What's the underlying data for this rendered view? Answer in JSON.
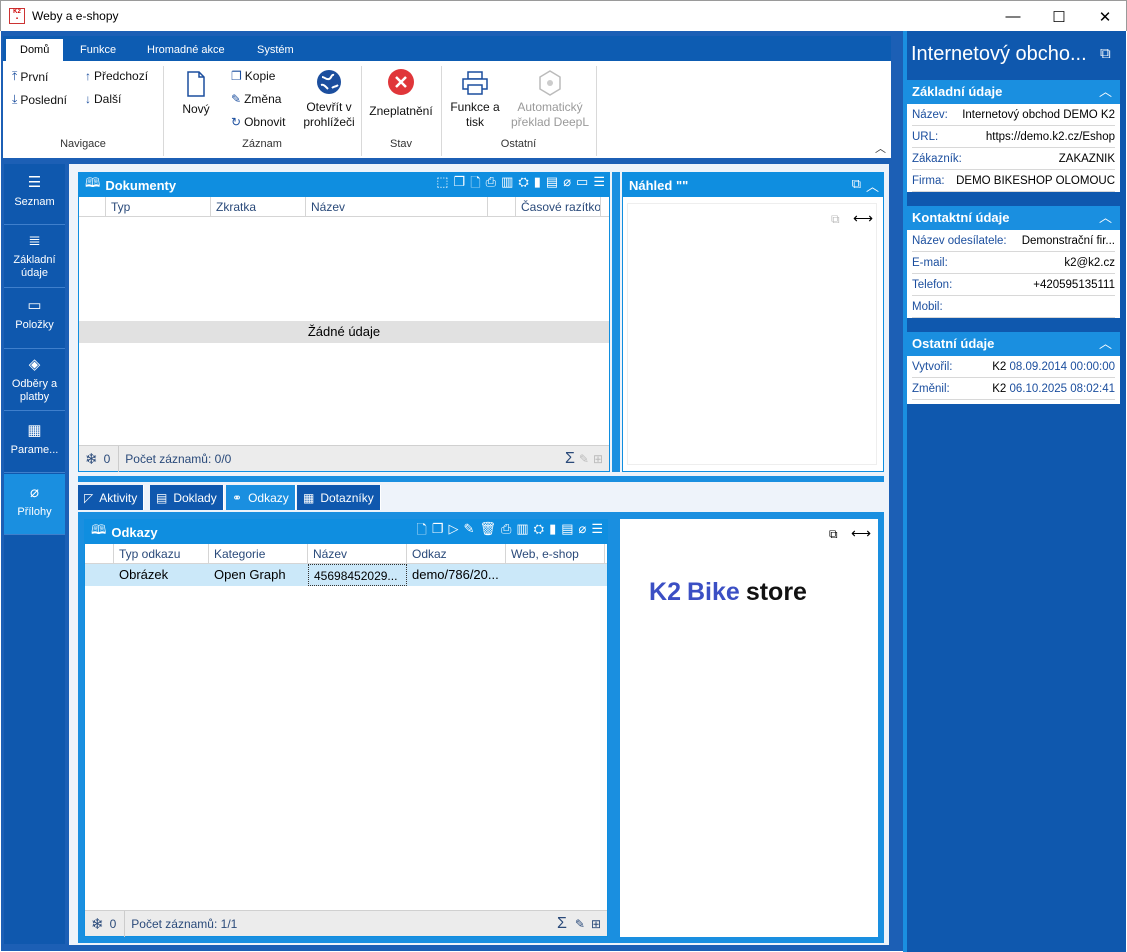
{
  "window": {
    "title": "Weby a e-shopy",
    "minimize": "—",
    "maximize": "☐",
    "close": "✕"
  },
  "ribbon": {
    "tabs": [
      "Domů",
      "Funkce",
      "Hromadné akce",
      "Systém"
    ],
    "nav": {
      "first": "První",
      "last": "Poslední",
      "prev": "Předchozí",
      "next": "Další",
      "group": "Navigace"
    },
    "record": {
      "new": "Nový",
      "copy": "Kopie",
      "change": "Změna",
      "refresh": "Obnovit",
      "open_line1": "Otevřít v",
      "open_line2": "prohlížeči",
      "group": "Záznam"
    },
    "state": {
      "cancel": "Zneplatnění",
      "group": "Stav"
    },
    "other": {
      "func_line1": "Funkce a",
      "func_line2": "tisk",
      "deepl_line1": "Automatický",
      "deepl_line2": "překlad DeepL",
      "group": "Ostatní"
    }
  },
  "leftnav": [
    {
      "label": "Seznam",
      "icon": "☰"
    },
    {
      "label": "Základní údaje",
      "icon": "≣"
    },
    {
      "label": "Položky",
      "icon": "▭"
    },
    {
      "label": "Odběry a platby",
      "icon": "◈"
    },
    {
      "label": "Parame...",
      "icon": "▦"
    },
    {
      "label": "Přílohy",
      "icon": "⌀"
    }
  ],
  "documents": {
    "title": "Dokumenty",
    "columns": [
      "Typ",
      "Zkratka",
      "Název",
      "Časové razítko"
    ],
    "empty": "Žádné údaje",
    "count": "0",
    "records": "Počet záznamů: 0/0"
  },
  "preview": {
    "title": "Náhled \"\""
  },
  "bottom_tabs": [
    "Aktivity",
    "Doklady",
    "Odkazy",
    "Dotazníky"
  ],
  "links": {
    "title": "Odkazy",
    "columns": [
      "Typ odkazu",
      "Kategorie",
      "Název",
      "Odkaz",
      "Web, e-shop"
    ],
    "rows": [
      {
        "type": "Obrázek",
        "category": "Open Graph",
        "name": "45698452029...",
        "link": "demo/786/20...",
        "web": ""
      }
    ],
    "count": "0",
    "records": "Počet záznamů: 1/1"
  },
  "logo": {
    "k2": "K2",
    "bike": "Bike",
    "store": "store",
    "k2_color": "#3b4fc4"
  },
  "right": {
    "title": "Internetový obcho...",
    "basic": {
      "title": "Základní údaje",
      "name_label": "Název:",
      "name": "Internetový obchod DEMO K2",
      "url_label": "URL:",
      "url": "https://demo.k2.cz/Eshop",
      "customer_label": "Zákazník:",
      "customer": "ZÁKAZNÍK",
      "company_label": "Firma:",
      "company": "DEMO BIKESHOP OLOMOUC"
    },
    "contact": {
      "title": "Kontaktní údaje",
      "sender_label": "Název odesílatele:",
      "sender": "Demonstrační fir...",
      "email_label": "E-mail:",
      "email": "k2@k2.cz",
      "phone_label": "Telefon:",
      "phone": "+420595135111",
      "mobile_label": "Mobil:",
      "mobile": ""
    },
    "other": {
      "title": "Ostatní údaje",
      "created_label": "Vytvořil:",
      "created_user": "K2",
      "created_date": "08.09.2014 00:00:00",
      "changed_label": "Změnil:",
      "changed_user": "K2",
      "changed_date": "06.10.2025 08:02:41"
    }
  }
}
